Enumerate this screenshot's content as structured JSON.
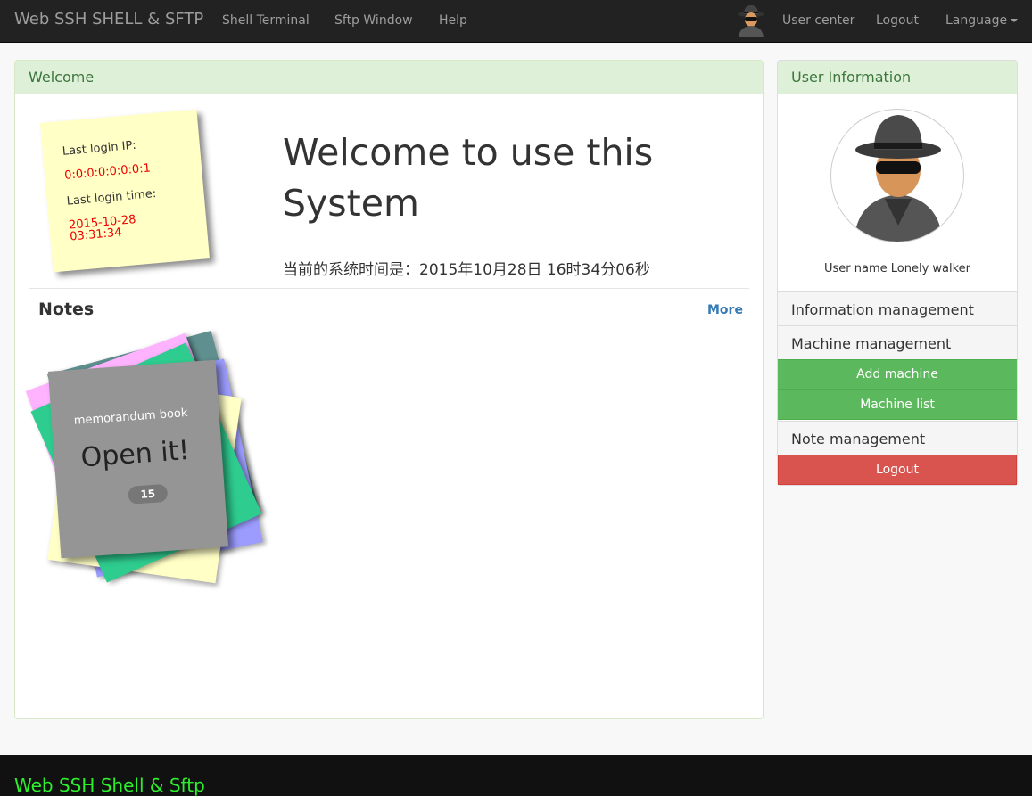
{
  "navbar": {
    "brand": "Web SSH SHELL & SFTP",
    "links": [
      "Shell Terminal",
      "Sftp Window",
      "Help"
    ],
    "user_center": "User center",
    "logout": "Logout",
    "language": "Language"
  },
  "welcome": {
    "heading": "Welcome",
    "last_login_ip_label": "Last login IP:",
    "last_login_ip": "0:0:0:0:0:0:0:1",
    "last_login_time_label": "Last login time:",
    "last_login_time": "2015-10-28 03:31:34",
    "title": "Welcome to use this System",
    "system_time": "当前的系统时间是：2015年10月28日 16时34分06秒"
  },
  "notes": {
    "title": "Notes",
    "more": "More",
    "memo_label": "memorandum book",
    "open_label": "Open it!",
    "count": "15"
  },
  "user_info": {
    "heading": "User Information",
    "username": "User name Lonely walker",
    "menu": {
      "information_management": "Information management",
      "machine_management": "Machine management",
      "add_machine": "Add machine",
      "machine_list": "Machine list",
      "note_management": "Note management",
      "logout": "Logout"
    }
  },
  "footer": {
    "text": "Web SSH Shell & Sftp"
  },
  "colors": {
    "navbar_bg": "#222222",
    "panel_heading_bg": "#dff0d8",
    "success": "#5cb85c",
    "danger": "#d9534f",
    "link": "#337ab7",
    "footer_text": "#2cf02c",
    "note_yellow": "#ffffc6",
    "memo_gray": "#959595"
  },
  "icons": {
    "avatar": "spy-avatar-icon",
    "caret": "caret-down-icon"
  }
}
